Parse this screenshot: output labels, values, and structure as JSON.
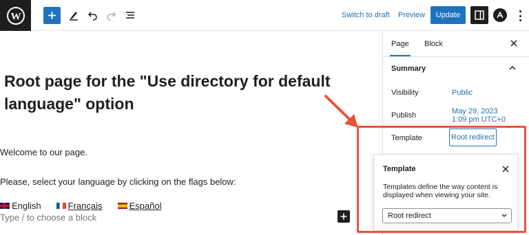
{
  "toolbar": {
    "switch_to_draft": "Switch to draft",
    "preview": "Preview",
    "update": "Update",
    "icons": [
      "wordpress-logo",
      "add-block",
      "edit-pencil",
      "undo",
      "redo",
      "document-overview",
      "settings-sidebar",
      "plugin-a",
      "more-options"
    ]
  },
  "editor": {
    "title": "Root page for the \"Use directory for default language\" option",
    "paragraph_1": "Welcome to our page.",
    "paragraph_2": "Please, select your language by clicking on the flags below:",
    "languages": [
      {
        "label": "English",
        "linked": false
      },
      {
        "label": "Français",
        "linked": true
      },
      {
        "label": "Español",
        "linked": true
      }
    ],
    "block_placeholder": "Type / to choose a block"
  },
  "sidebar": {
    "tabs": [
      {
        "label": "Page",
        "active": true
      },
      {
        "label": "Block",
        "active": false
      }
    ],
    "summary_heading": "Summary",
    "visibility_label": "Visibility",
    "visibility_value": "Public",
    "publish_label": "Publish",
    "publish_date": "May 29, 2023",
    "publish_time": "1:09 pm UTC+0",
    "template_label": "Template",
    "template_value": "Root redirect"
  },
  "template_popover": {
    "title": "Template",
    "description": "Templates define the way content is displayed when viewing your site.",
    "selected_option": "Root redirect"
  },
  "colors": {
    "accent": "#1e73be",
    "link": "#2271b1",
    "annotation": "#e8533c"
  }
}
